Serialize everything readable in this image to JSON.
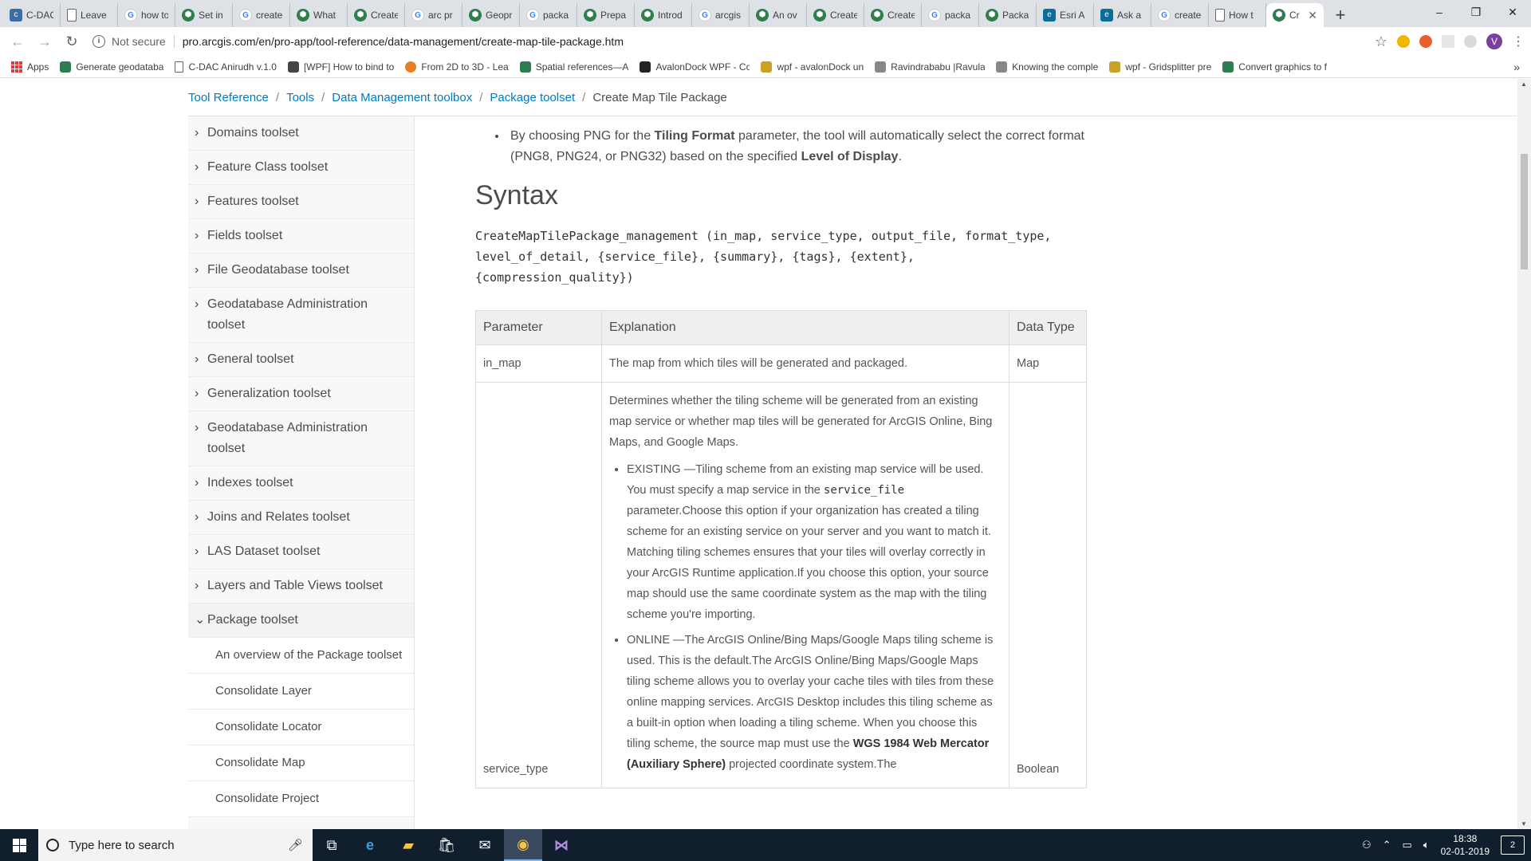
{
  "browser": {
    "tabs": [
      {
        "label": "C-DAC",
        "icon": "cdac-icon"
      },
      {
        "label": "Leave",
        "icon": "doc-icon"
      },
      {
        "label": "how to",
        "icon": "google-icon"
      },
      {
        "label": "Set in",
        "icon": "stackexchange-icon"
      },
      {
        "label": "create",
        "icon": "google-icon"
      },
      {
        "label": "What",
        "icon": "stackexchange-icon"
      },
      {
        "label": "Create",
        "icon": "stackexchange-icon"
      },
      {
        "label": "arc pr",
        "icon": "google-icon"
      },
      {
        "label": "Geopr",
        "icon": "stackexchange-icon"
      },
      {
        "label": "packa",
        "icon": "google-icon"
      },
      {
        "label": "Prepa",
        "icon": "stackexchange-icon"
      },
      {
        "label": "Introd",
        "icon": "stackexchange-icon"
      },
      {
        "label": "arcgis",
        "icon": "google-icon"
      },
      {
        "label": "An ov",
        "icon": "stackexchange-icon"
      },
      {
        "label": "Create",
        "icon": "stackexchange-icon"
      },
      {
        "label": "Create",
        "icon": "stackexchange-icon"
      },
      {
        "label": "packa",
        "icon": "google-icon"
      },
      {
        "label": "Packa",
        "icon": "stackexchange-icon"
      },
      {
        "label": "Esri A",
        "icon": "esri-icon"
      },
      {
        "label": "Ask a",
        "icon": "esri-icon"
      },
      {
        "label": "create",
        "icon": "google-icon"
      },
      {
        "label": "How t",
        "icon": "doc-icon"
      },
      {
        "label": "Cr",
        "icon": "stackexchange-icon",
        "active": true
      }
    ],
    "new_tab": "+",
    "window": {
      "minimize": "–",
      "maximize": "❐",
      "close": "✕"
    },
    "security_label": "Not secure",
    "url": "pro.arcgis.com/en/pro-app/tool-reference/data-management/create-map-tile-package.htm",
    "avatar_letter": "V",
    "bookmarks": [
      {
        "label": "Apps",
        "icon": "apps-icon"
      },
      {
        "label": "Generate geodataba",
        "icon": "stackexchange-icon"
      },
      {
        "label": "C-DAC Anirudh v.1.0",
        "icon": "doc-icon"
      },
      {
        "label": "[WPF] How to bind to",
        "icon": "wpf-icon"
      },
      {
        "label": "From 2D to 3D - Lea",
        "icon": "orange-icon"
      },
      {
        "label": "Spatial references—A",
        "icon": "stackexchange-icon"
      },
      {
        "label": "AvalonDock WPF - CodeP",
        "icon": "codeproject-icon"
      },
      {
        "label": "wpf - avalonDock un",
        "icon": "stackoverflow-icon"
      },
      {
        "label": "Ravindrababu |Ravula",
        "icon": "gray-icon"
      },
      {
        "label": "Knowing the comple",
        "icon": "gray-icon"
      },
      {
        "label": "wpf - Gridsplitter pre",
        "icon": "stackoverflow-icon"
      },
      {
        "label": "Convert graphics to f",
        "icon": "stackexchange-icon"
      }
    ],
    "bookmarks_more": "»"
  },
  "breadcrumb": [
    "Tool Reference",
    "Tools",
    "Data Management toolbox",
    "Package toolset",
    "Create Map Tile Package"
  ],
  "sidebar": {
    "items": [
      {
        "label": "Domains toolset",
        "expanded": false
      },
      {
        "label": "Feature Class toolset",
        "expanded": false
      },
      {
        "label": "Features toolset",
        "expanded": false
      },
      {
        "label": "Fields toolset",
        "expanded": false
      },
      {
        "label": "File Geodatabase toolset",
        "expanded": false
      },
      {
        "label": "Geodatabase Administration toolset",
        "expanded": false
      },
      {
        "label": "General toolset",
        "expanded": false
      },
      {
        "label": "Generalization toolset",
        "expanded": false
      },
      {
        "label": "Geodatabase Administration toolset",
        "expanded": false
      },
      {
        "label": "Indexes toolset",
        "expanded": false
      },
      {
        "label": "Joins and Relates toolset",
        "expanded": false
      },
      {
        "label": "LAS Dataset toolset",
        "expanded": false
      },
      {
        "label": "Layers and Table Views toolset",
        "expanded": false
      },
      {
        "label": "Package toolset",
        "expanded": true
      }
    ],
    "subitems": [
      "An overview of the Package toolset",
      "Consolidate Layer",
      "Consolidate Locator",
      "Consolidate Map",
      "Consolidate Project"
    ]
  },
  "content": {
    "note": {
      "pre": "By choosing PNG for the ",
      "bold1": "Tiling Format",
      "mid": " parameter, the tool will automatically select the correct format (PNG8, PNG24, or PNG32) based on the specified ",
      "bold2": "Level of Display",
      "post": "."
    },
    "syntax_heading": "Syntax",
    "syntax_lines": [
      "CreateMapTilePackage_management (in_map, service_type, output_file, format_type,",
      "level_of_detail, {service_file}, {summary}, {tags}, {extent},",
      "{compression_quality})"
    ],
    "table": {
      "headers": [
        "Parameter",
        "Explanation",
        "Data Type"
      ],
      "row1": {
        "param": "in_map",
        "explanation": "The map from which tiles will be generated and packaged.",
        "type": "Map"
      },
      "row2": {
        "param": "service_type",
        "type": "Boolean",
        "intro": "Determines whether the tiling scheme will be generated from an existing map service or whether map tiles will be generated for ArcGIS Online, Bing Maps, and Google Maps.",
        "existing_pre": "EXISTING —Tiling scheme from an existing map service will be used. You must specify a map service in the ",
        "existing_code": "service_file",
        "existing_post": " parameter.Choose this option if your organization has created a tiling scheme for an existing service on your server and you want to match it. Matching tiling schemes ensures that your tiles will overlay correctly in your ArcGIS Runtime application.If you choose this option, your source map should use the same coordinate system as the map with the tiling scheme you're importing.",
        "online_pre": "ONLINE —The ArcGIS Online/Bing Maps/Google Maps tiling scheme is used. This is the default.The ArcGIS Online/Bing Maps/Google Maps tiling scheme allows you to overlay your cache tiles with tiles from these online mapping services. ArcGIS Desktop includes this tiling scheme as a built-in option when loading a tiling scheme. When you choose this tiling scheme, the source map must use the ",
        "online_bold": "WGS 1984 Web Mercator (Auxiliary Sphere)",
        "online_post": " projected coordinate system.The"
      }
    }
  },
  "taskbar": {
    "search_placeholder": "Type here to search",
    "time": "18:38",
    "date": "02-01-2019",
    "notifications": "2"
  }
}
